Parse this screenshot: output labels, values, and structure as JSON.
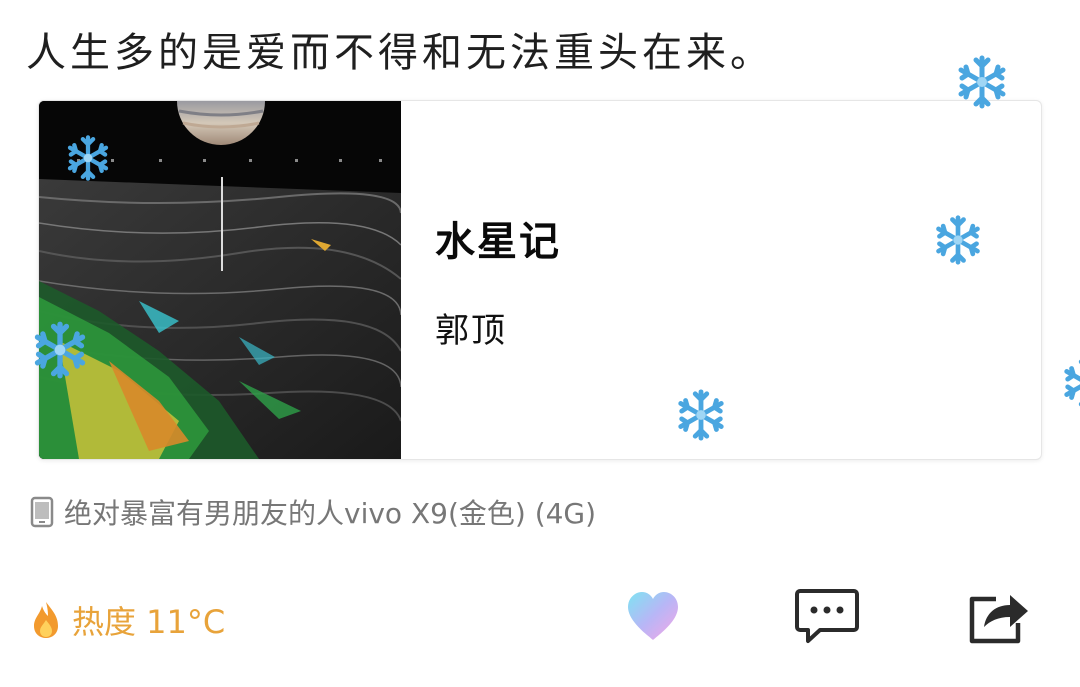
{
  "post": {
    "text": "人生多的是爱而不得和无法重头在来。"
  },
  "music_card": {
    "title": "水星记",
    "artist": "郭顶",
    "cover_icon": "album-cover"
  },
  "device": {
    "icon": "phone-icon",
    "label": "绝对暴富有男朋友的人vivo X9(金色) (4G)"
  },
  "heat": {
    "icon": "flame-icon",
    "label": "热度 11°C"
  },
  "actions": {
    "like_icon": "heart-icon",
    "comment_icon": "comment-icon",
    "share_icon": "share-icon"
  },
  "colors": {
    "heat_text": "#e8a33a",
    "snowflake": "#4aa6e0"
  }
}
